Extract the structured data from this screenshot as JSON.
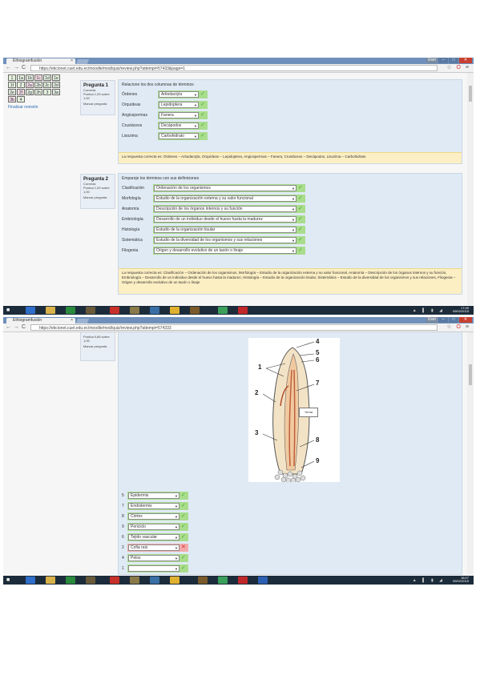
{
  "shot1": {
    "tab_title": "Ethiogramfusión",
    "tab_close": "×",
    "url": "https://eticionet.cuet.edu.ec/moodle/mod/quiz/review.php?attempt=57433&page=1",
    "window_buttons": {
      "user": "User",
      "minimize": "–",
      "maximize": "□",
      "close": "✕"
    },
    "nav": {
      "back": "←",
      "forward": "→",
      "reload": "C"
    },
    "toolbar_icons": {
      "star": "☆",
      "opera": "O",
      "menu": "≡"
    },
    "quiz_nav": {
      "cells": [
        "1",
        "1a",
        "1b",
        "1c",
        "1d",
        "1e",
        "1f",
        "2",
        "2a",
        "2b",
        "2c",
        "2d",
        "2e",
        "2f",
        "2g",
        "2h",
        "3",
        "3a",
        "3b",
        "4"
      ],
      "finish_review": "Finalizar revisión"
    },
    "q1": {
      "title": "Pregunta 1",
      "status": "Correcta",
      "marks": "Puntúa 1,00 sobre 1,00",
      "flag": "Marcar pregunta",
      "text": "Relacione los dos columnas de términos",
      "rows": [
        {
          "label": "Órdenes",
          "value": "Artiodactyla"
        },
        {
          "label": "Orquídeas",
          "value": "Lepidoptera"
        },
        {
          "label": "Angiospermas",
          "value": "Fanera"
        },
        {
          "label": "Crustáceos",
          "value": "Decápodos"
        },
        {
          "label": "Lisozima",
          "value": "Carbohidrato"
        }
      ],
      "feedback": "La respuesta correcta es: Órdenes – Artiodactyla, Orquídeas – Lepidoptera, Angiospermas – Fanera, Crustáceos – Decápodos, Lisozima – Carbohidrato"
    },
    "q2": {
      "title": "Pregunta 2",
      "status": "Correcta",
      "marks": "Puntúa 1,00 sobre 1,00",
      "flag": "Marcar pregunta",
      "text": "Empareje los términos con sus definiciones",
      "rows": [
        {
          "label": "Clasificación",
          "value": "Ordenación de los organismos"
        },
        {
          "label": "Morfología",
          "value": "Estudio de la organización externa y su valor funcional"
        },
        {
          "label": "Anatomía",
          "value": "Descripción de los órganos internos y su función"
        },
        {
          "label": "Embriología",
          "value": "Desarrollo de un individuo desde el huevo hasta la madurez"
        },
        {
          "label": "Histología",
          "value": "Estudio de la organización tisular"
        },
        {
          "label": "Sistemática",
          "value": "Estudio de la diversidad de los organismos y sus relaciones"
        },
        {
          "label": "Filogenia",
          "value": "Origen y desarrollo evolutivo de un taxón o linaje"
        }
      ],
      "feedback": "La respuesta correcta es: Clasificación – Ordenación de los organismos, Morfología – Estudio de la organización externa y su valor funcional, Anatomía – Descripción de los órganos internos y su función, Embriología – Desarrollo de un individuo desde el huevo hasta la madurez, Histología – Estudio de la organización tisular, Sistemática – Estudio de la diversidad de los organismos y sus relaciones, Filogenia – Origen y desarrollo evolutivo de un taxón o linaje"
    },
    "clock": {
      "time": "17:49",
      "date": "09/02/2015"
    }
  },
  "shot2": {
    "tab_title": "Ethiogramfusión",
    "tab_close": "×",
    "url": "https://eticionet.cuet.edu.ec/moodle/mod/quiz/review.php?attempt=574333",
    "window_buttons": {
      "user": "User",
      "minimize": "–",
      "maximize": "□",
      "close": "✕"
    },
    "nav": {
      "back": "←",
      "forward": "→",
      "reload": "C"
    },
    "toolbar_icons": {
      "star": "☆",
      "opera": "O",
      "menu": "≡"
    },
    "info": {
      "marks": "Puntúa 0,86 sobre 1,00",
      "flag": "Marcar pregunta"
    },
    "figure_numbers": [
      "1",
      "2",
      "3",
      "4",
      "5",
      "6",
      "7",
      "8",
      "9"
    ],
    "tooltip": "Yema",
    "rows": [
      {
        "num": "5",
        "value": "Epidermis",
        "correct": true
      },
      {
        "num": "7",
        "value": "Endodermis",
        "correct": true
      },
      {
        "num": "8",
        "value": "Córtex",
        "correct": true
      },
      {
        "num": "9",
        "value": "Periciclo",
        "correct": true
      },
      {
        "num": "6",
        "value": "Tejido vascular",
        "correct": true
      },
      {
        "num": "2",
        "value": "Cofia raíz",
        "correct": false
      },
      {
        "num": "4",
        "value": "Pelos",
        "correct": true
      },
      {
        "num": "1",
        "value": "",
        "correct": true
      }
    ],
    "clock": {
      "time": "18:07",
      "date": "09/02/2015"
    }
  }
}
